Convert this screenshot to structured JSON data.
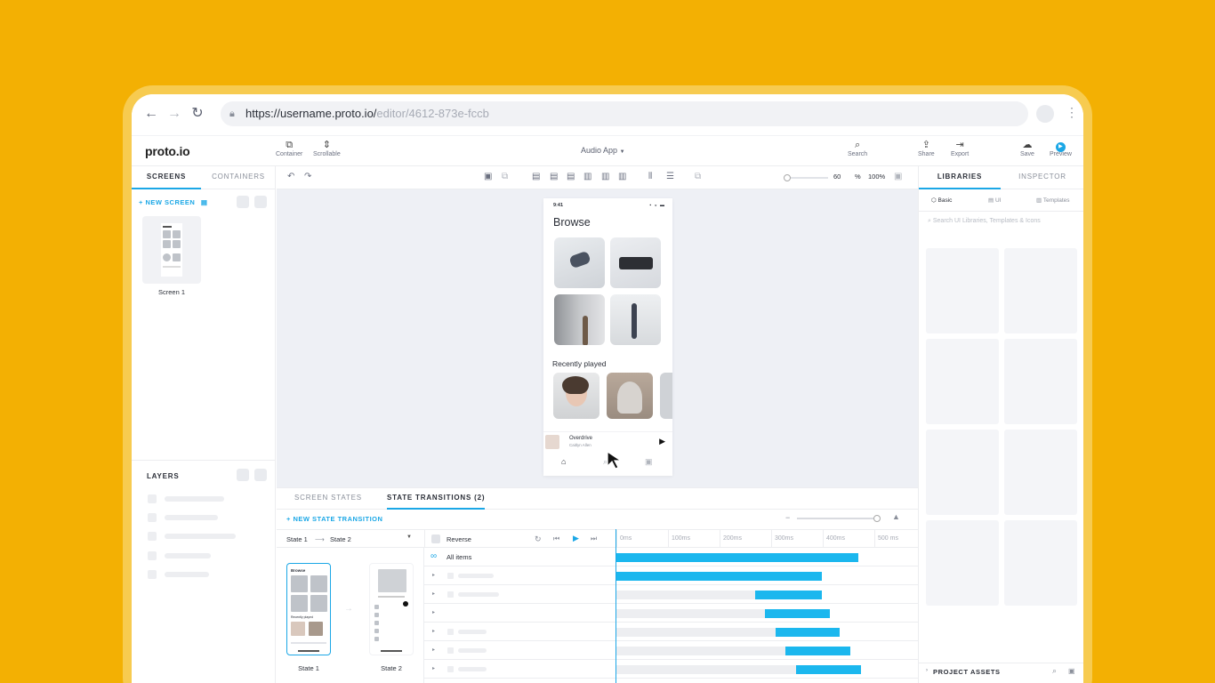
{
  "browser": {
    "url_host": "https://username.proto.io/",
    "url_path": "editor/4612-873e-fccb"
  },
  "toolbar": {
    "logo": "proto.io",
    "container_label": "Container",
    "scrollable_label": "Scrollable",
    "project_name": "Audio App",
    "search_label": "Search",
    "share_label": "Share",
    "export_label": "Export",
    "save_label": "Save",
    "preview_label": "Preview"
  },
  "left_panel": {
    "tabs": [
      "SCREENS",
      "CONTAINERS"
    ],
    "new_screen": "+ NEW SCREEN",
    "screen_name": "Screen 1",
    "layers_title": "LAYERS"
  },
  "center_toolbar": {
    "zoom_value": "60",
    "zoom_unit": "%",
    "zoom_fit": "100%"
  },
  "phone": {
    "time": "9:41",
    "title": "Browse",
    "recent_title": "Recently played",
    "track_title": "Overdrive",
    "track_artist": "Caitlyn Allen"
  },
  "bottom_panel": {
    "tabs": [
      "SCREEN STATES",
      "STATE TRANSITIONS (2)"
    ],
    "new_transition": "+ NEW STATE TRANSITION",
    "from_state": "State 1",
    "arrow": "⟶",
    "to_state": "State 2",
    "reverse_label": "Reverse",
    "all_items_label": "All items",
    "ticks": [
      "0ms",
      "100ms",
      "200ms",
      "300ms",
      "400ms",
      "500 ms"
    ],
    "state1_label": "State 1",
    "state2_label": "State 2",
    "state1_thumb_title": "Browse",
    "state1_thumb_recent": "Recently played",
    "rows": [
      {
        "delay_ms": 0,
        "duration_ms": 470
      },
      {
        "delay_ms": 0,
        "duration_ms": 400
      },
      {
        "delay_ms": 270,
        "duration_ms": 130
      },
      {
        "delay_ms": 290,
        "duration_ms": 125
      },
      {
        "delay_ms": 310,
        "duration_ms": 125
      },
      {
        "delay_ms": 330,
        "duration_ms": 125
      },
      {
        "delay_ms": 350,
        "duration_ms": 125
      }
    ]
  },
  "right_panel": {
    "tabs": [
      "LIBRARIES",
      "INSPECTOR"
    ],
    "lib_tabs": [
      "Basic",
      "UI",
      "Templates"
    ],
    "search_placeholder": "Search UI Libraries, Templates & Icons",
    "project_assets": "PROJECT ASSETS"
  },
  "colors": {
    "background": "#F3B003",
    "accent": "#1BA7E6",
    "bar": "#1BB7EE"
  }
}
